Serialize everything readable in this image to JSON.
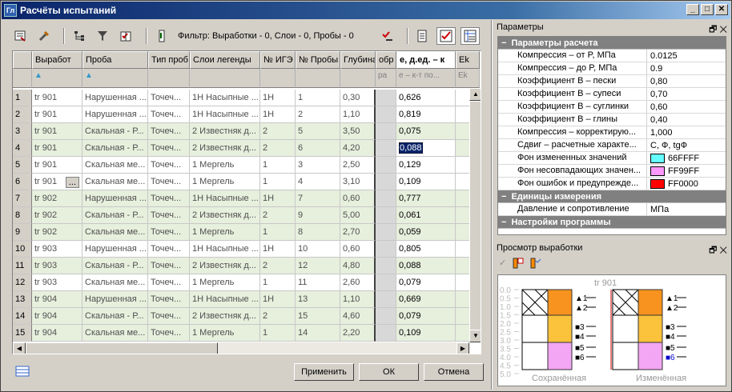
{
  "window": {
    "title": "Расчёты испытаний",
    "icon_text": "Гл",
    "min": "_",
    "max": "□",
    "close": "✕"
  },
  "toolbar": {
    "filter_text": "Фильтр: Выработки - 0, Слои - 0, Пробы - 0"
  },
  "grid": {
    "headers": [
      "",
      "Выработ",
      "Проба",
      "Тип проб",
      "Слои легенды",
      "№ ИГЭ",
      "№ Пробы",
      "Глубина",
      "обр",
      "е, д.ед. – к",
      "Ek"
    ],
    "filter_cells": [
      "",
      "",
      "",
      "",
      "",
      "",
      "",
      "",
      "ра",
      "е – к-т по...",
      "Ek"
    ],
    "rows": [
      [
        "1",
        "tr 901",
        "Нарушенная ...",
        "Точеч...",
        "1Н Насыпные ...",
        "1Н",
        "1",
        "0,30",
        "0,626"
      ],
      [
        "2",
        "tr 901",
        "Нарушенная ...",
        "Точеч...",
        "1Н Насыпные ...",
        "1Н",
        "2",
        "1,10",
        "0,819"
      ],
      [
        "3",
        "tr 901",
        "Скальная - Р...",
        "Точеч...",
        "2 Известняк д...",
        "2",
        "5",
        "3,50",
        "0,075"
      ],
      [
        "4",
        "tr 901",
        "Скальная - Р...",
        "Точеч...",
        "2 Известняк д...",
        "2",
        "6",
        "4,20",
        "0,088"
      ],
      [
        "5",
        "tr 901",
        "Скальная ме...",
        "Точеч...",
        "1 Мергель",
        "1",
        "3",
        "2,50",
        "0,129"
      ],
      [
        "6",
        "tr 901",
        "Скальная ме...",
        "Точеч...",
        "1 Мергель",
        "1",
        "4",
        "3,10",
        "0,109"
      ],
      [
        "7",
        "tr 902",
        "Нарушенная ...",
        "Точеч...",
        "1Н Насыпные ...",
        "1Н",
        "7",
        "0,60",
        "0,777"
      ],
      [
        "8",
        "tr 902",
        "Скальная - Р...",
        "Точеч...",
        "2 Известняк д...",
        "2",
        "9",
        "5,00",
        "0,061"
      ],
      [
        "9",
        "tr 902",
        "Скальная ме...",
        "Точеч...",
        "1 Мергель",
        "1",
        "8",
        "2,70",
        "0,059"
      ],
      [
        "10",
        "tr 903",
        "Нарушенная ...",
        "Точеч...",
        "1Н Насыпные ...",
        "1Н",
        "10",
        "0,60",
        "0,805"
      ],
      [
        "11",
        "tr 903",
        "Скальная - Р...",
        "Точеч...",
        "2 Известняк д...",
        "2",
        "12",
        "4,80",
        "0,088"
      ],
      [
        "12",
        "tr 903",
        "Скальная ме...",
        "Точеч...",
        "1 Мергель",
        "1",
        "11",
        "2,60",
        "0,079"
      ],
      [
        "13",
        "tr 904",
        "Нарушенная ...",
        "Точеч...",
        "1Н Насыпные ...",
        "1Н",
        "13",
        "1,10",
        "0,669"
      ],
      [
        "14",
        "tr 904",
        "Скальная - Р...",
        "Точеч...",
        "2 Известняк д...",
        "2",
        "15",
        "4,60",
        "0,079"
      ],
      [
        "15",
        "tr 904",
        "Скальная ме...",
        "Точеч...",
        "1 Мергель",
        "1",
        "14",
        "2,20",
        "0,109"
      ]
    ],
    "ellipsis": "..."
  },
  "buttons": {
    "apply": "Применить",
    "ok": "ОК",
    "cancel": "Отмена"
  },
  "params": {
    "title": "Параметры",
    "pin": "🗗",
    "close": "✕",
    "section1": "Параметры расчета",
    "items": [
      {
        "k": "Компрессия – от P, МПа",
        "v": "0.0125"
      },
      {
        "k": "Компрессия – до P, МПа",
        "v": "0.9"
      },
      {
        "k": "Коэффициент В – пески",
        "v": "0,80"
      },
      {
        "k": "Коэффициент В – супеси",
        "v": "0,70"
      },
      {
        "k": "Коэффициент В – суглинки",
        "v": "0,60"
      },
      {
        "k": "Коэффициент В – глины",
        "v": "0,40"
      },
      {
        "k": "Компрессия – корректирую...",
        "v": "1,000"
      },
      {
        "k": "Сдвиг – расчетные характе...",
        "v": "С, Ф, tgФ"
      },
      {
        "k": "Фон измененных значений",
        "v": "66FFFF",
        "color": "#66FFFF"
      },
      {
        "k": "Фон несовпадающих значен...",
        "v": "FF99FF",
        "color": "#FF99FF"
      },
      {
        "k": "Фон ошибок и предупрежде...",
        "v": "FF0000",
        "color": "#FF0000"
      }
    ],
    "section2": "Единицы измерения",
    "units": [
      {
        "k": "Давление и сопротивление",
        "v": "МПа"
      }
    ],
    "section3": "Настройки программы"
  },
  "preview": {
    "title": "Просмотр выработки",
    "pin": "🗗",
    "close": "✕",
    "well": "tr 901",
    "saved": "Сохранённая",
    "changed": "Изменённая",
    "depths": [
      "0.0",
      "0.5",
      "1.0",
      "1.5",
      "2.0",
      "2.5",
      "3.0",
      "3.5",
      "4.0",
      "4.5",
      "5.0"
    ],
    "marks_left": [
      "▲1",
      "▲2",
      "■3",
      "■4",
      "■5",
      "■6"
    ],
    "marks_right": [
      "▲1",
      "▲2",
      "■3",
      "■4",
      "■5",
      "■6"
    ]
  }
}
